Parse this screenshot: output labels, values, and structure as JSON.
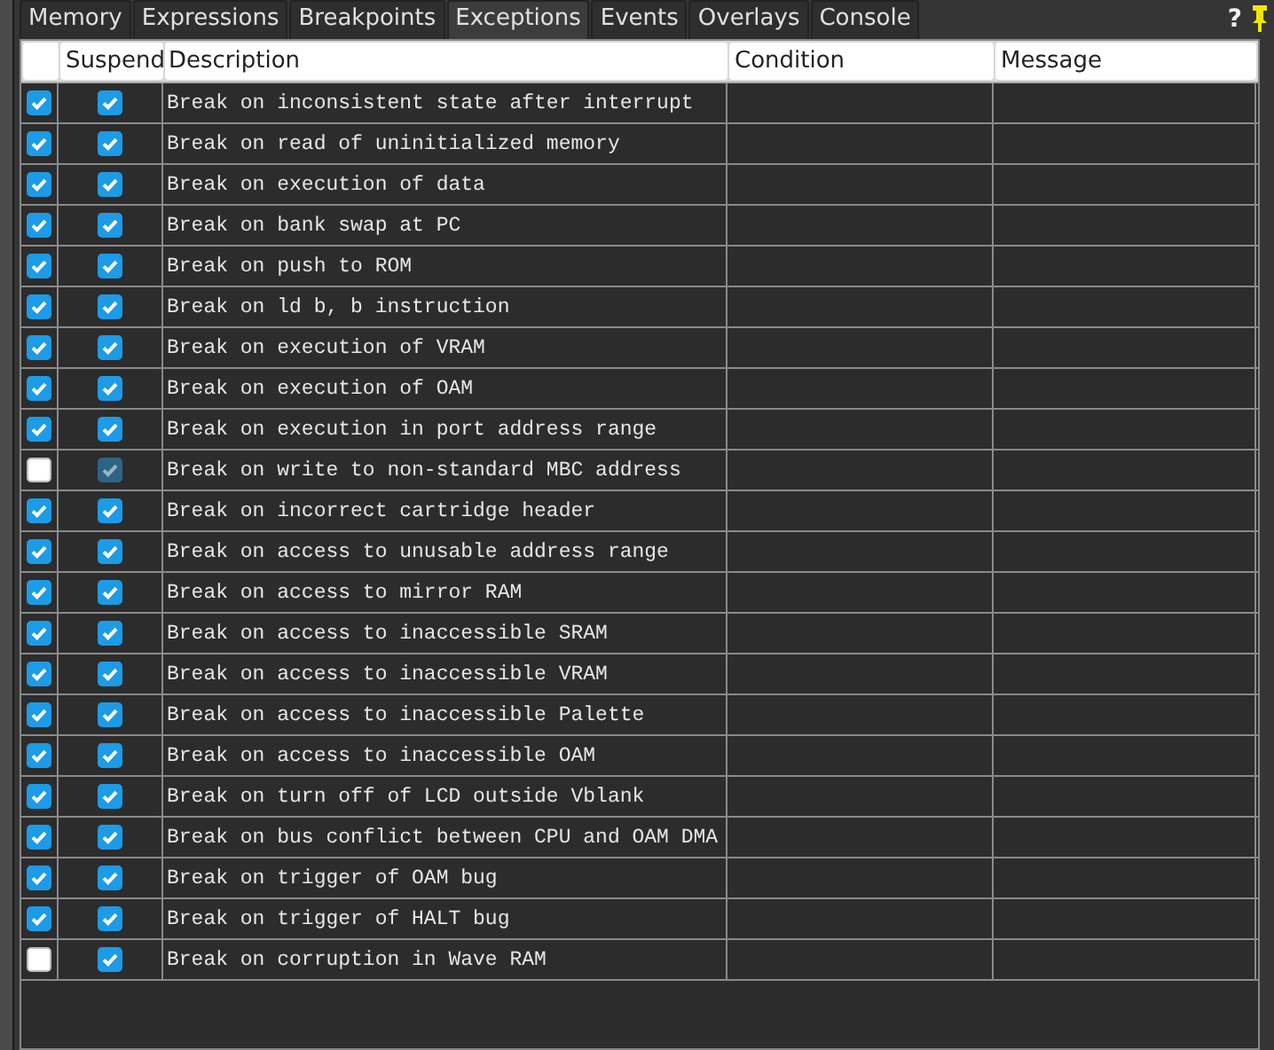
{
  "tabs": [
    {
      "label": "Memory",
      "selected": false
    },
    {
      "label": "Expressions",
      "selected": false
    },
    {
      "label": "Breakpoints",
      "selected": false
    },
    {
      "label": "Exceptions",
      "selected": true
    },
    {
      "label": "Events",
      "selected": false
    },
    {
      "label": "Overlays",
      "selected": false
    },
    {
      "label": "Console",
      "selected": false
    }
  ],
  "help": "?",
  "table": {
    "columns": [
      "Suspend",
      "Description",
      "Condition",
      "Message"
    ],
    "rows": [
      {
        "enabled": true,
        "suspend": true,
        "suspend_disabled": false,
        "description": "Break on inconsistent state after interrupt"
      },
      {
        "enabled": true,
        "suspend": true,
        "suspend_disabled": false,
        "description": "Break on read of uninitialized memory"
      },
      {
        "enabled": true,
        "suspend": true,
        "suspend_disabled": false,
        "description": "Break on execution of data"
      },
      {
        "enabled": true,
        "suspend": true,
        "suspend_disabled": false,
        "description": "Break on bank swap at PC"
      },
      {
        "enabled": true,
        "suspend": true,
        "suspend_disabled": false,
        "description": "Break on push to ROM"
      },
      {
        "enabled": true,
        "suspend": true,
        "suspend_disabled": false,
        "description": "Break on ld b, b instruction"
      },
      {
        "enabled": true,
        "suspend": true,
        "suspend_disabled": false,
        "description": "Break on execution of VRAM"
      },
      {
        "enabled": true,
        "suspend": true,
        "suspend_disabled": false,
        "description": "Break on execution of OAM"
      },
      {
        "enabled": true,
        "suspend": true,
        "suspend_disabled": false,
        "description": "Break on execution in port address range"
      },
      {
        "enabled": false,
        "suspend": true,
        "suspend_disabled": true,
        "description": "Break on write to non-standard MBC address"
      },
      {
        "enabled": true,
        "suspend": true,
        "suspend_disabled": false,
        "description": "Break on incorrect cartridge header"
      },
      {
        "enabled": true,
        "suspend": true,
        "suspend_disabled": false,
        "description": "Break on access to unusable address range"
      },
      {
        "enabled": true,
        "suspend": true,
        "suspend_disabled": false,
        "description": "Break on access to mirror RAM"
      },
      {
        "enabled": true,
        "suspend": true,
        "suspend_disabled": false,
        "description": "Break on access to inaccessible SRAM"
      },
      {
        "enabled": true,
        "suspend": true,
        "suspend_disabled": false,
        "description": "Break on access to inaccessible VRAM"
      },
      {
        "enabled": true,
        "suspend": true,
        "suspend_disabled": false,
        "description": "Break on access to inaccessible Palette"
      },
      {
        "enabled": true,
        "suspend": true,
        "suspend_disabled": false,
        "description": "Break on access to inaccessible OAM"
      },
      {
        "enabled": true,
        "suspend": true,
        "suspend_disabled": false,
        "description": "Break on turn off of LCD outside Vblank"
      },
      {
        "enabled": true,
        "suspend": true,
        "suspend_disabled": false,
        "description": "Break on bus conflict between CPU and OAM DMA"
      },
      {
        "enabled": true,
        "suspend": true,
        "suspend_disabled": false,
        "description": "Break on trigger of OAM bug"
      },
      {
        "enabled": true,
        "suspend": true,
        "suspend_disabled": false,
        "description": "Break on trigger of HALT bug"
      },
      {
        "enabled": false,
        "suspend": true,
        "suspend_disabled": false,
        "description": "Break on corruption in Wave RAM"
      }
    ]
  }
}
